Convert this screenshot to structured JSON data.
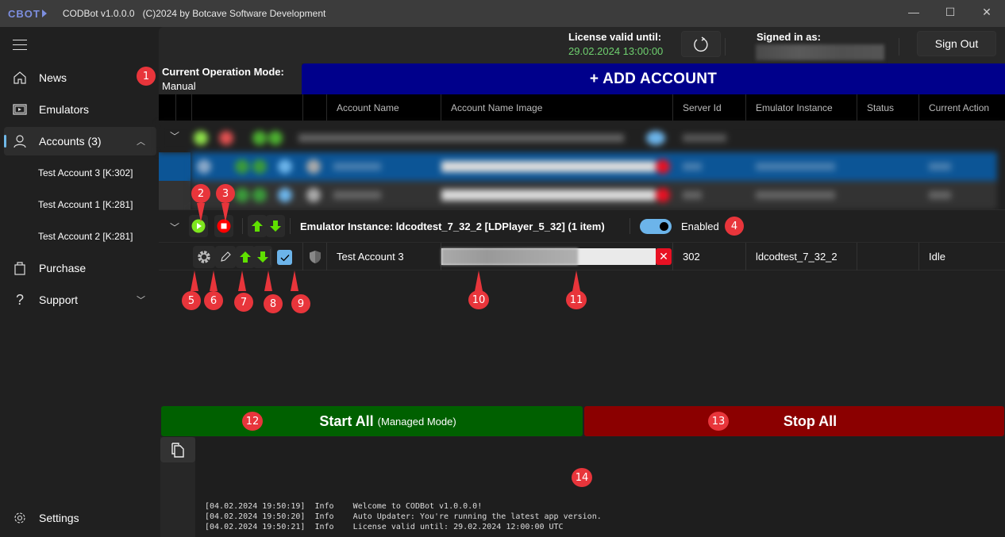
{
  "titlebar": {
    "logo": "CBOT",
    "title": "CODBot v1.0.0.0",
    "copyright": "(C)2024 by Botcave Software Development",
    "minimize": "—",
    "maximize": "☐",
    "close": "✕"
  },
  "sidebar": {
    "menu_icon": "hamburger-icon",
    "items": [
      {
        "label": "News",
        "icon": "home-icon"
      },
      {
        "label": "Emulators",
        "icon": "emulator-icon"
      },
      {
        "label": "Accounts (3)",
        "icon": "person-icon",
        "expanded": true
      },
      {
        "label": "Purchase",
        "icon": "shopping-bag-icon"
      },
      {
        "label": "Support",
        "icon": "question-icon",
        "expanded": false
      }
    ],
    "sub_items": [
      "Test Account 3 [K:302]",
      "Test Account 1 [K:281]",
      "Test Account 2 [K:281]"
    ],
    "settings": "Settings"
  },
  "header": {
    "license_label": "License valid until:",
    "license_value": "29.02.2024 13:00:00",
    "signed_in_label": "Signed in as:",
    "signed_in_value": "",
    "sign_out": "Sign Out"
  },
  "operation_mode": {
    "label": "Current Operation Mode:",
    "value": "Manual"
  },
  "add_account": "+ ADD ACCOUNT",
  "grid": {
    "columns": [
      "Account Name",
      "Account Name Image",
      "Server Id",
      "Emulator Instance",
      "Status",
      "Current Action"
    ],
    "group": {
      "title": "Emulator Instance: ldcodtest_7_32_2 [LDPlayer_5_32] (1 item)",
      "enabled": true,
      "enabled_label": "Enabled"
    },
    "rows": [
      {
        "account_name": "Test Account 3",
        "server_id": "302",
        "emulator_instance": "ldcodtest_7_32_2",
        "status": "",
        "current_action": "Idle",
        "checked": true
      }
    ]
  },
  "actions": {
    "start_all": "Start All",
    "start_all_sub": "(Managed Mode)",
    "stop_all": "Stop All"
  },
  "log": [
    {
      "time": "[04.02.2024 19:50:19]",
      "level": "Info",
      "message": "Welcome to CODBot v1.0.0.0!"
    },
    {
      "time": "[04.02.2024 19:50:20]",
      "level": "Info",
      "message": "Auto Updater: You're running the latest app version."
    },
    {
      "time": "[04.02.2024 19:50:21]",
      "level": "Info",
      "message": "License valid until: 29.02.2024 12:00:00 UTC"
    }
  ],
  "markers": [
    "1",
    "2",
    "3",
    "4",
    "5",
    "6",
    "7",
    "8",
    "9",
    "10",
    "11",
    "12",
    "13",
    "14"
  ],
  "colors": {
    "accent": "#6cb4ea",
    "add_account": "#00008b",
    "start": "#006000",
    "stop": "#8b0000",
    "license": "#6fd06f",
    "marker": "#e8353b"
  }
}
